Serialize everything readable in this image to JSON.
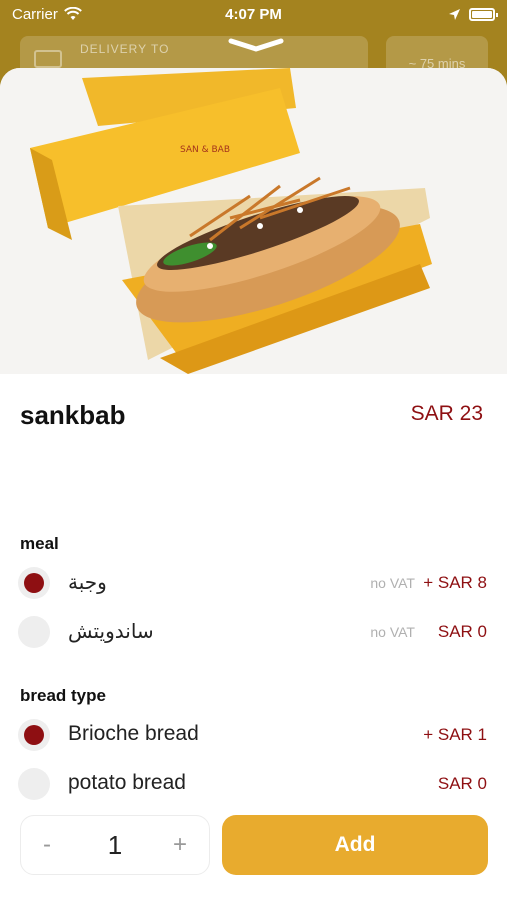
{
  "status_bar": {
    "carrier": "Carrier",
    "time": "4:07 PM"
  },
  "background": {
    "delivery_label": "DELIVERY TO",
    "delivery_time": "~ 75 mins"
  },
  "product": {
    "name": "sankbab",
    "price": "SAR 23"
  },
  "sections": [
    {
      "title": "meal",
      "options": [
        {
          "label": "وجبة",
          "vat": "no VAT",
          "price": "+ SAR 8",
          "selected": true
        },
        {
          "label": "ساندويتش",
          "vat": "no VAT",
          "price": "SAR 0",
          "selected": false
        }
      ]
    },
    {
      "title": "bread type",
      "options": [
        {
          "label": "Brioche bread",
          "vat": "",
          "price": "+ SAR 1",
          "selected": true
        },
        {
          "label": "potato bread",
          "vat": "",
          "price": "SAR 0",
          "selected": false
        }
      ]
    }
  ],
  "quantity": {
    "minus": "-",
    "value": "1",
    "plus": "+"
  },
  "add_button": {
    "label": "Add"
  },
  "colors": {
    "accent": "#8e0f12",
    "button": "#e8ab2e",
    "overlay": "#a4831f"
  }
}
